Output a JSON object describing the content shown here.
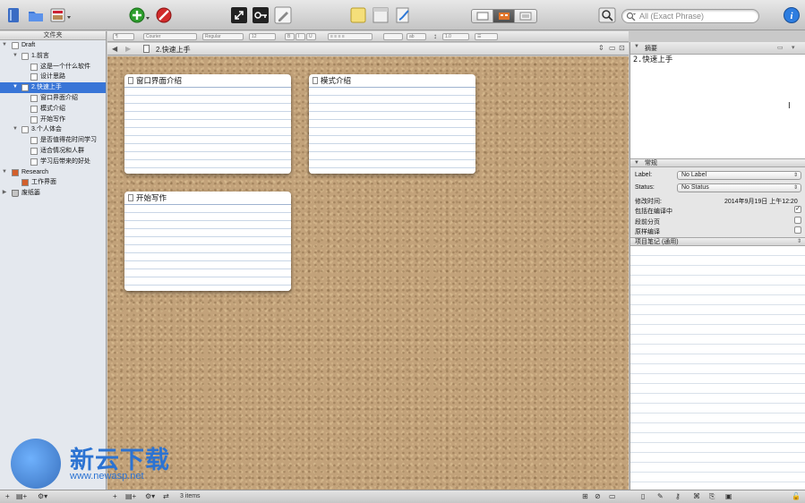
{
  "toolbar": {
    "search_placeholder": "All (Exact Phrase)"
  },
  "binder": {
    "header": "文件夹",
    "items": [
      {
        "label": "Draft",
        "level": 0,
        "icon": "draft-icon",
        "expanded": true
      },
      {
        "label": "1.前言",
        "level": 1,
        "icon": "folder-icon",
        "expanded": true
      },
      {
        "label": "这是一个什么软件",
        "level": 2,
        "icon": "document-icon"
      },
      {
        "label": "设计思路",
        "level": 2,
        "icon": "document-icon"
      },
      {
        "label": "2.快速上手",
        "level": 1,
        "icon": "folder-icon",
        "expanded": true,
        "selected": true
      },
      {
        "label": "窗口界面介绍",
        "level": 2,
        "icon": "document-icon"
      },
      {
        "label": "模式介绍",
        "level": 2,
        "icon": "document-icon"
      },
      {
        "label": "开始写作",
        "level": 2,
        "icon": "document-icon"
      },
      {
        "label": "3.个人体会",
        "level": 1,
        "icon": "folder-icon",
        "expanded": true
      },
      {
        "label": "是否值得花时间学习",
        "level": 2,
        "icon": "document-icon"
      },
      {
        "label": "适合情况和人群",
        "level": 2,
        "icon": "document-icon"
      },
      {
        "label": "学习后带来的好处",
        "level": 2,
        "icon": "document-icon"
      },
      {
        "label": "Research",
        "level": 0,
        "icon": "research-icon",
        "expanded": true
      },
      {
        "label": "工作界面",
        "level": 1,
        "icon": "image-icon"
      },
      {
        "label": "废纸篓",
        "level": 0,
        "icon": "trash-icon",
        "expanded": false
      }
    ]
  },
  "formatbar": {
    "font": "Courier",
    "style": "Regular",
    "size": "12",
    "bold": "B",
    "italic": "I",
    "underline": "U",
    "line_spacing": "1.0"
  },
  "editor": {
    "title": "2.快速上手",
    "cards": [
      {
        "title": "窗口界面介绍"
      },
      {
        "title": "模式介绍"
      },
      {
        "title": "开始写作"
      }
    ]
  },
  "inspector": {
    "synopsis_header": "摘要",
    "synopsis_text": "2.快速上手",
    "general_header": "常规",
    "label_field": "Label:",
    "label_value": "No Label",
    "status_field": "Status:",
    "status_value": "No Status",
    "modified_label": "修改时间:",
    "modified_value": "2014年9月19日 上午12:20",
    "include_compile": "包括在编译中",
    "include_compile_checked": true,
    "page_break": "段前分页",
    "compile_as_is": "原样编译",
    "notes_header": "项目笔记 (通用)"
  },
  "status_bar": {
    "items_count": "3 items"
  },
  "watermark": {
    "title": "新云下载",
    "url": "www.newasp.net"
  },
  "colors": {
    "selection": "#3875d7",
    "cork": "#c2a27a",
    "add_button": "#2e9e2e",
    "delete_button": "#d12a2a",
    "info_button": "#2d7de0"
  }
}
